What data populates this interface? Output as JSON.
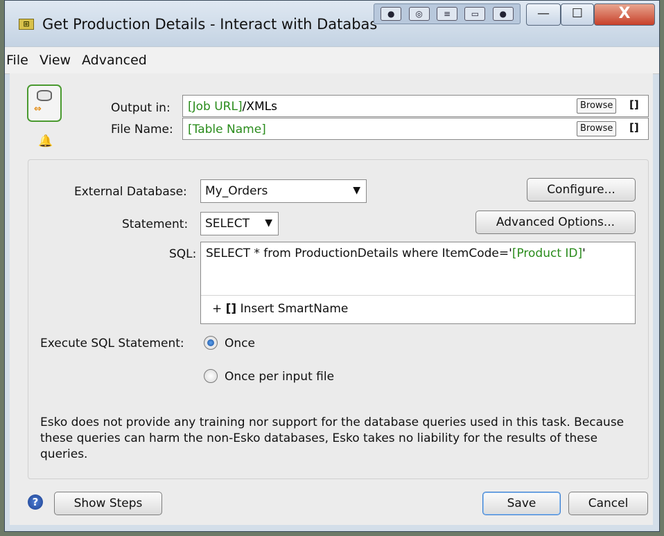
{
  "window": {
    "title": "Get Production Details - Interact with Databas",
    "app_icon": "app-logo-icon",
    "caption_buttons": {
      "minimize": "—",
      "maximize": "☐",
      "close": "X"
    }
  },
  "menu": [
    "File",
    "View",
    "Advanced"
  ],
  "output": {
    "output_in_label": "Output in:",
    "output_in_smartname": "[Job URL]",
    "output_in_suffix": "/XMLs",
    "file_name_label": "File Name:",
    "file_name_smartname": "[Table Name]",
    "browse_label": "Browse",
    "smartname_bracket": "[]"
  },
  "database": {
    "external_label": "External Database:",
    "external_value": "My_Orders",
    "configure_label": "Configure...",
    "statement_label": "Statement:",
    "statement_value": "SELECT",
    "advanced_options_label": "Advanced Options...",
    "sql_label": "SQL:",
    "sql_prefix": "SELECT * from ProductionDetails where ItemCode='",
    "sql_smartname": "[Product ID]",
    "sql_suffix": "'",
    "insert_smartname_plus": "+",
    "insert_smartname_bracket": "[]",
    "insert_smartname_label": "Insert SmartName"
  },
  "execute": {
    "label": "Execute SQL Statement:",
    "options": [
      {
        "label": "Once",
        "selected": true
      },
      {
        "label": "Once per input file",
        "selected": false
      }
    ]
  },
  "disclaimer": "Esko does not provide any training nor support for the database queries used in this task. Because these queries can harm the non-Esko databases, Esko takes no liability for the results of these queries.",
  "footer": {
    "help_glyph": "?",
    "show_steps_label": "Show Steps",
    "save_label": "Save",
    "cancel_label": "Cancel"
  },
  "colors": {
    "smartname_green": "#2a8c1c",
    "window_bg": "#d3dee9",
    "radio_selected": "#1a4f9c"
  }
}
